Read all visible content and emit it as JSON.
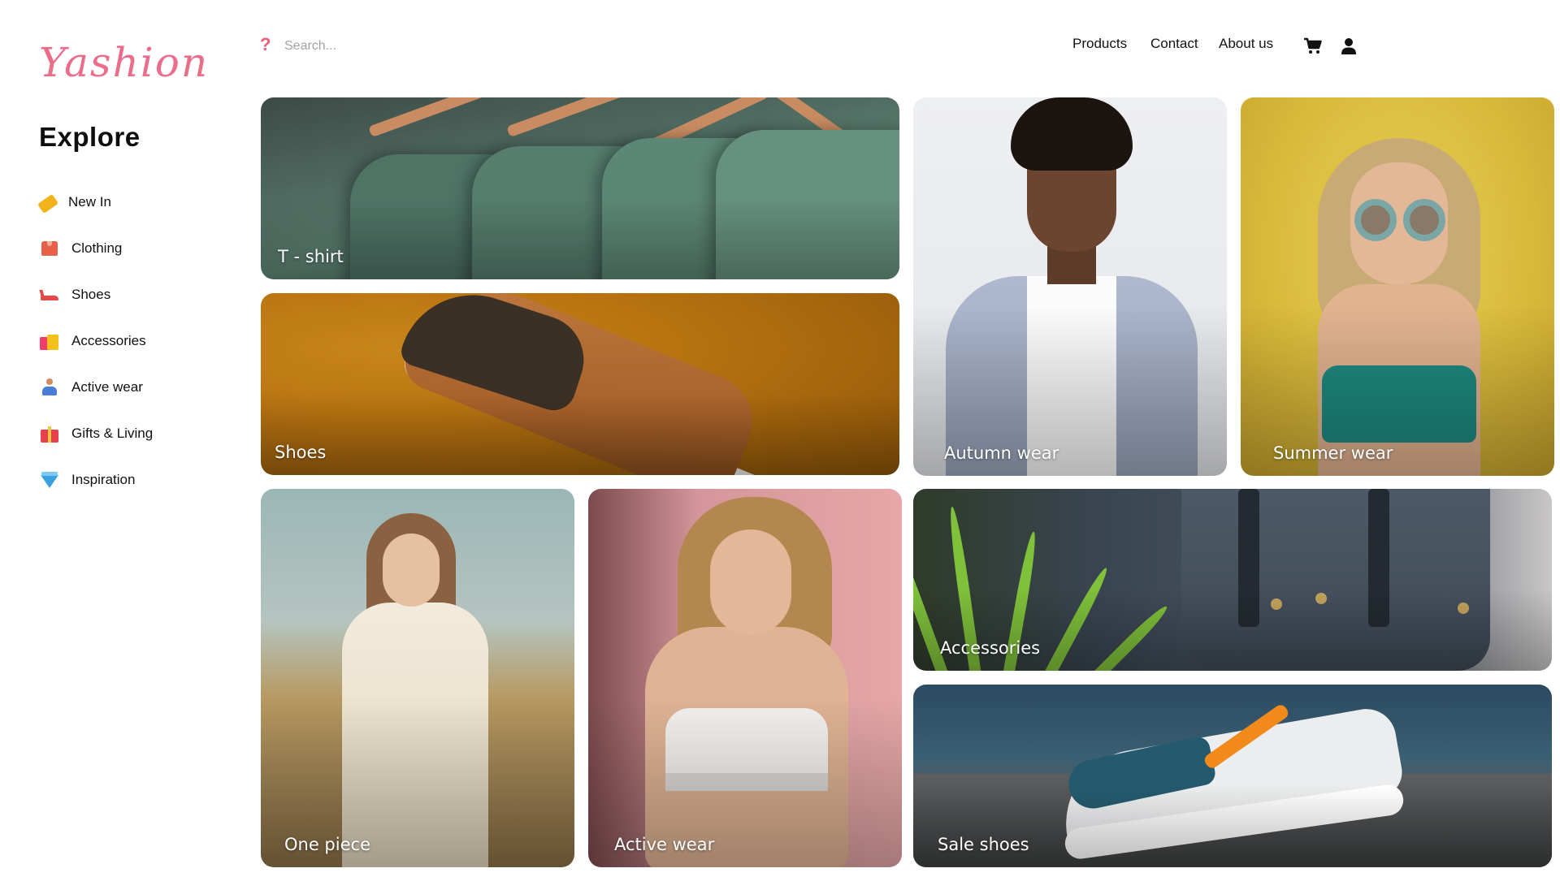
{
  "brand": {
    "logo_text": "Yashion",
    "accent_color": "#ea6d8a"
  },
  "sidebar": {
    "heading": "Explore",
    "items": [
      {
        "label": "New In",
        "icon": "price-tag-icon"
      },
      {
        "label": "Clothing",
        "icon": "shirt-icon"
      },
      {
        "label": "Shoes",
        "icon": "high-heel-icon"
      },
      {
        "label": "Accessories",
        "icon": "shopping-bags-icon"
      },
      {
        "label": "Active wear",
        "icon": "yoga-person-icon"
      },
      {
        "label": "Gifts & Living",
        "icon": "gift-icon"
      },
      {
        "label": "Inspiration",
        "icon": "gem-icon"
      }
    ]
  },
  "header": {
    "search_icon": "?",
    "search_placeholder": "Search...",
    "nav": [
      "Products",
      "Contact",
      "About us"
    ],
    "cart_icon": "cart-icon",
    "user_icon": "user-icon"
  },
  "tiles": [
    {
      "label": "T - shirt"
    },
    {
      "label": "Shoes"
    },
    {
      "label": "Autumn wear"
    },
    {
      "label": "Summer wear"
    },
    {
      "label": "One piece"
    },
    {
      "label": "Active wear"
    },
    {
      "label": "Accessories"
    },
    {
      "label": "Sale shoes"
    }
  ]
}
